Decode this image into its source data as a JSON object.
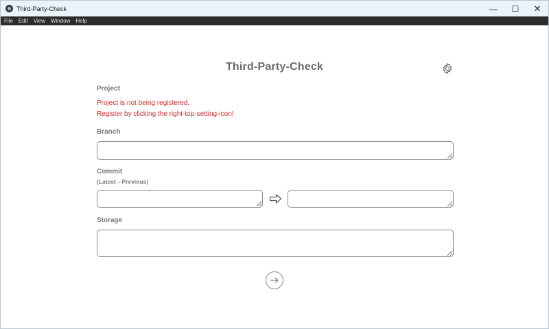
{
  "window": {
    "title": "Third-Party-Check",
    "controls": {
      "minimize": "—",
      "maximize": "☐",
      "close": "✕"
    }
  },
  "menu": [
    "File",
    "Edit",
    "View",
    "Window",
    "Help"
  ],
  "main": {
    "title": "Third-Party-Check",
    "project_label": "Project",
    "project_error_line1": "Project is not being registered.",
    "project_error_line2": "Register by clicking the right-top-setting-icon!",
    "branch_label": "Branch",
    "branch_value": "",
    "commit_label": "Commit",
    "commit_hint": "(Latest→Previous)",
    "commit_latest_value": "",
    "commit_previous_value": "",
    "storage_label": "Storage",
    "storage_value": ""
  },
  "icons": {
    "settings": "gear-icon",
    "commit_arrow": "arrow-right-outline-icon",
    "next": "arrow-right-circle-icon"
  },
  "colors": {
    "error": "#d12b2b",
    "label": "#7a7a7a",
    "title": "#6a6a6a",
    "menubar": "#2b2b2b",
    "titlebar": "#eaf3f8"
  }
}
